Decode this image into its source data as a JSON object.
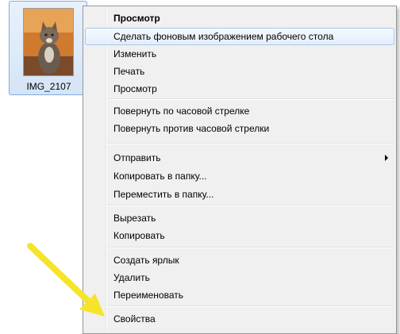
{
  "file": {
    "name": "IMG_2107",
    "thumbnail": "cat-photo-thumbnail"
  },
  "context_menu": {
    "items": [
      {
        "label": "Просмотр",
        "bold": true
      },
      {
        "label": "Сделать фоновым изображением рабочего стола",
        "highlighted": true
      },
      {
        "label": "Изменить"
      },
      {
        "label": "Печать"
      },
      {
        "label": "Просмотр"
      },
      {
        "label": "Повернуть по часовой стрелке"
      },
      {
        "label": "Повернуть против часовой стрелки"
      },
      {
        "label": "Отправить",
        "submenu": true
      },
      {
        "label": "Копировать в папку..."
      },
      {
        "label": "Переместить в папку..."
      },
      {
        "label": "Вырезать"
      },
      {
        "label": "Копировать"
      },
      {
        "label": "Создать ярлык"
      },
      {
        "label": "Удалить"
      },
      {
        "label": "Переименовать"
      },
      {
        "label": "Свойства"
      }
    ]
  },
  "annotation": {
    "arrow_color": "#f5e42a",
    "arrow_target": "Свойства"
  }
}
